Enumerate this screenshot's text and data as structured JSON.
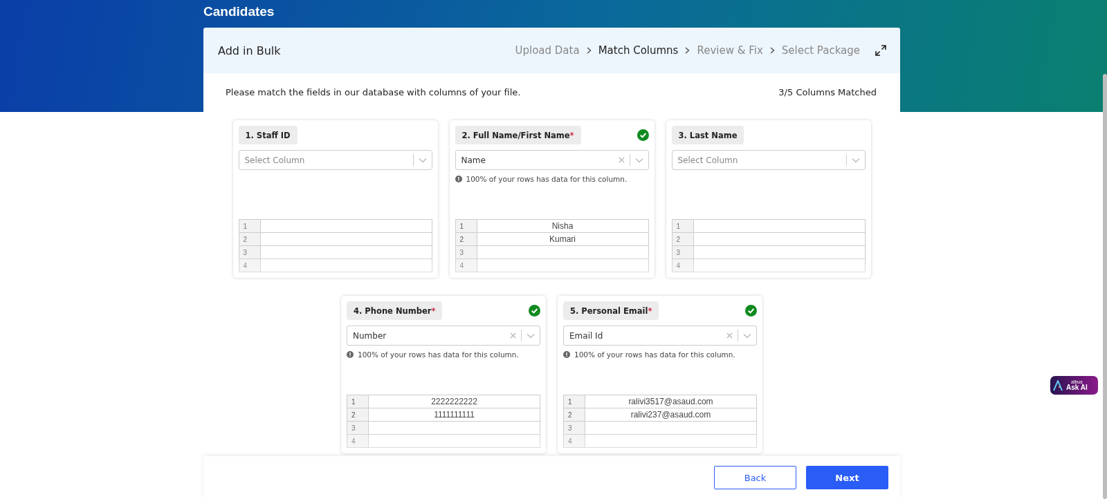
{
  "page": {
    "title": "Candidates"
  },
  "panel": {
    "title": "Add in Bulk",
    "steps": [
      {
        "label": "Upload Data",
        "selected": false
      },
      {
        "label": "Match Columns",
        "selected": true
      },
      {
        "label": "Review & Fix",
        "selected": false
      },
      {
        "label": "Select Package",
        "selected": false
      }
    ],
    "instruction": "Please match the fields in our database with columns of your file.",
    "match_count": "3/5 Columns Matched"
  },
  "fields": [
    {
      "label": "1. Staff ID",
      "matched": false,
      "placeholder": "Select Column",
      "rows": [
        {
          "number": "1"
        },
        {
          "number": "2"
        },
        {
          "number": "3"
        },
        {
          "number": "4"
        }
      ]
    },
    {
      "label": "2. Full Name/First Name",
      "required_mark": "*",
      "matched": true,
      "value": "Name",
      "note": "100% of your rows has data for this column.",
      "rows": [
        {
          "number": "1",
          "value": "Nisha"
        },
        {
          "number": "2",
          "value": "Kumari"
        },
        {
          "number": "3"
        },
        {
          "number": "4"
        }
      ]
    },
    {
      "label": "3. Last Name",
      "matched": false,
      "placeholder": "Select Column",
      "rows": [
        {
          "number": "1"
        },
        {
          "number": "2"
        },
        {
          "number": "3"
        },
        {
          "number": "4"
        }
      ]
    },
    {
      "label": "4. Phone Number",
      "required_mark": "*",
      "matched": true,
      "value": "Number",
      "note": "100% of your rows has data for this column.",
      "rows": [
        {
          "number": "1",
          "value": "2222222222"
        },
        {
          "number": "2",
          "value": "1111111111"
        },
        {
          "number": "3"
        },
        {
          "number": "4"
        }
      ]
    },
    {
      "label": "5. Personal Email",
      "required_mark": "*",
      "matched": true,
      "value": "Email Id",
      "note": "100% of your rows has data for this column.",
      "rows": [
        {
          "number": "1",
          "value": "ralivi3517@asaud.com"
        },
        {
          "number": "2",
          "value": "ralivi237@asaud.com"
        },
        {
          "number": "3"
        },
        {
          "number": "4"
        }
      ]
    }
  ],
  "buttons": [
    {
      "label": "Back",
      "kind": "secondary"
    },
    {
      "label": "Next",
      "kind": "primary"
    }
  ],
  "assistant": {
    "brand": "albus",
    "label": "Ask AI"
  }
}
